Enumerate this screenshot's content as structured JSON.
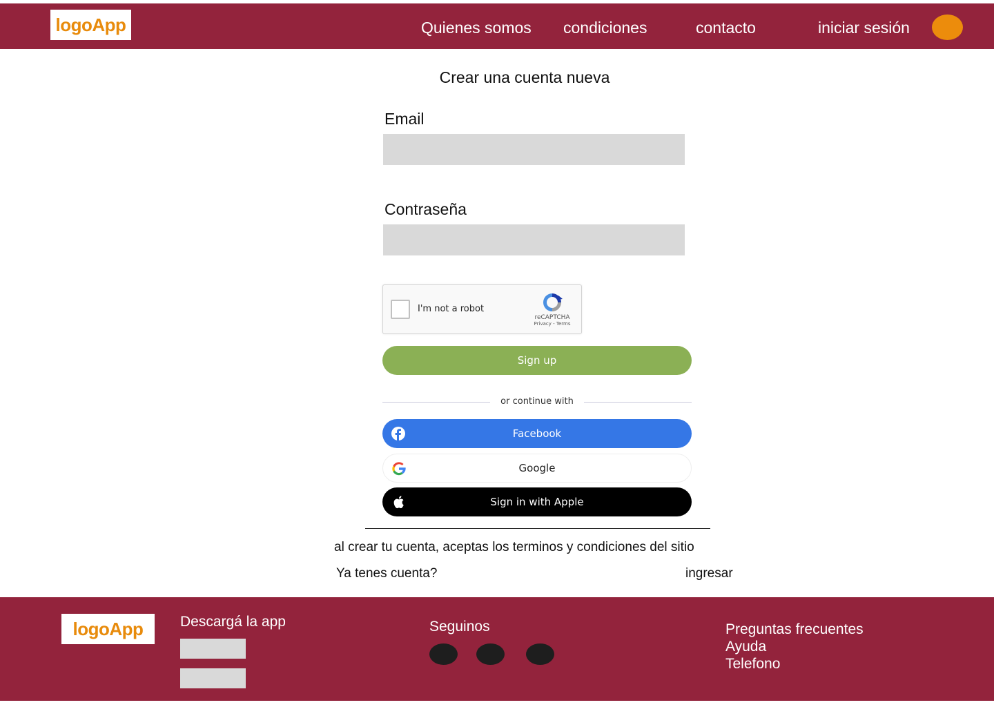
{
  "header": {
    "logo": "logoApp",
    "nav": [
      {
        "label": "Quienes somos"
      },
      {
        "label": "condiciones"
      },
      {
        "label": "contacto"
      },
      {
        "label": "iniciar sesión"
      }
    ],
    "avatar_color": "#ec8c0c"
  },
  "form": {
    "title": "Crear una cuenta nueva",
    "email_label": "Email",
    "email_value": "",
    "password_label": "Contraseña",
    "password_value": ""
  },
  "captcha": {
    "text": "I'm not a robot",
    "brand": "reCAPTCHA",
    "links": "Privacy - Terms",
    "checked": false
  },
  "buttons": {
    "signup": "Sign up",
    "divider": "or continue with",
    "facebook": "Facebook",
    "google": "Google",
    "apple": "Sign in with Apple"
  },
  "terms": {
    "text": "al crear tu cuenta, aceptas los terminos y condiciones del sitio",
    "have_account": "Ya tenes cuenta?",
    "login": "ingresar"
  },
  "footer": {
    "logo": "logoApp",
    "download": "Descargá la app",
    "follow": "Seguinos",
    "links": [
      "Preguntas frecuentes",
      "Ayuda",
      "Telefono"
    ]
  },
  "colors": {
    "brand": "#93233c",
    "logo_text": "#e88b0c",
    "signup": "#8bb055",
    "facebook": "#3577e6",
    "apple": "#000000",
    "input_bg": "#d9d9d9"
  },
  "icons": [
    "facebook-icon",
    "google-icon",
    "apple-icon",
    "recaptcha-icon"
  ]
}
